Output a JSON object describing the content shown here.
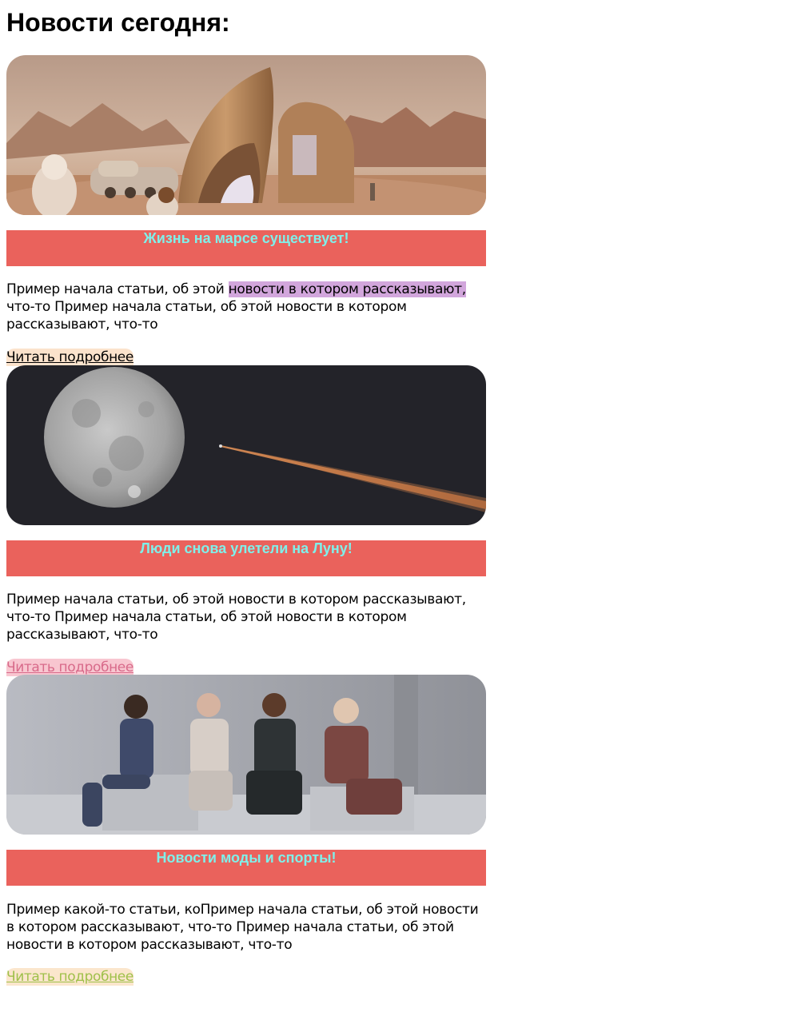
{
  "page": {
    "title": "Новости сегодня:"
  },
  "colors": {
    "headline_bar": "#ea625c",
    "headline_text": "#7ff0ea",
    "highlight": "#d2a6dc"
  },
  "articles": [
    {
      "image": "mars-habitat-image",
      "headline": "Жизнь на марсе существует!",
      "text_before": "Пример начала статьи, об этой ",
      "text_highlight": "новости в котором рассказывают,",
      "text_after": " что-то Пример начала статьи, об этой новости в котором рассказывают, что-то",
      "link": "Читать подробнее",
      "link_color": "#000000",
      "link_bg": "#fbe3cc"
    },
    {
      "image": "moon-rocket-image",
      "headline": "Люди снова улетели на Луну!",
      "text": "Пример начала статьи, об этой новости в котором рассказывают, что-то Пример начала статьи, об этой новости в котором рассказывают, что-то",
      "link": "Читать подробнее",
      "link_color": "#d86a8a",
      "link_bg": "#f8c6d0"
    },
    {
      "image": "fashion-models-image",
      "headline": "Новости моды и спорты!",
      "text": "Пример какой-то статьи, коПример начала статьи, об этой новости в котором рассказывают, что-то Пример начала статьи, об этой новости в котором рассказывают, что-то",
      "link": "Читать подробнее",
      "link_color": "#9fc04a",
      "link_bg": "#fbe6cc"
    }
  ]
}
